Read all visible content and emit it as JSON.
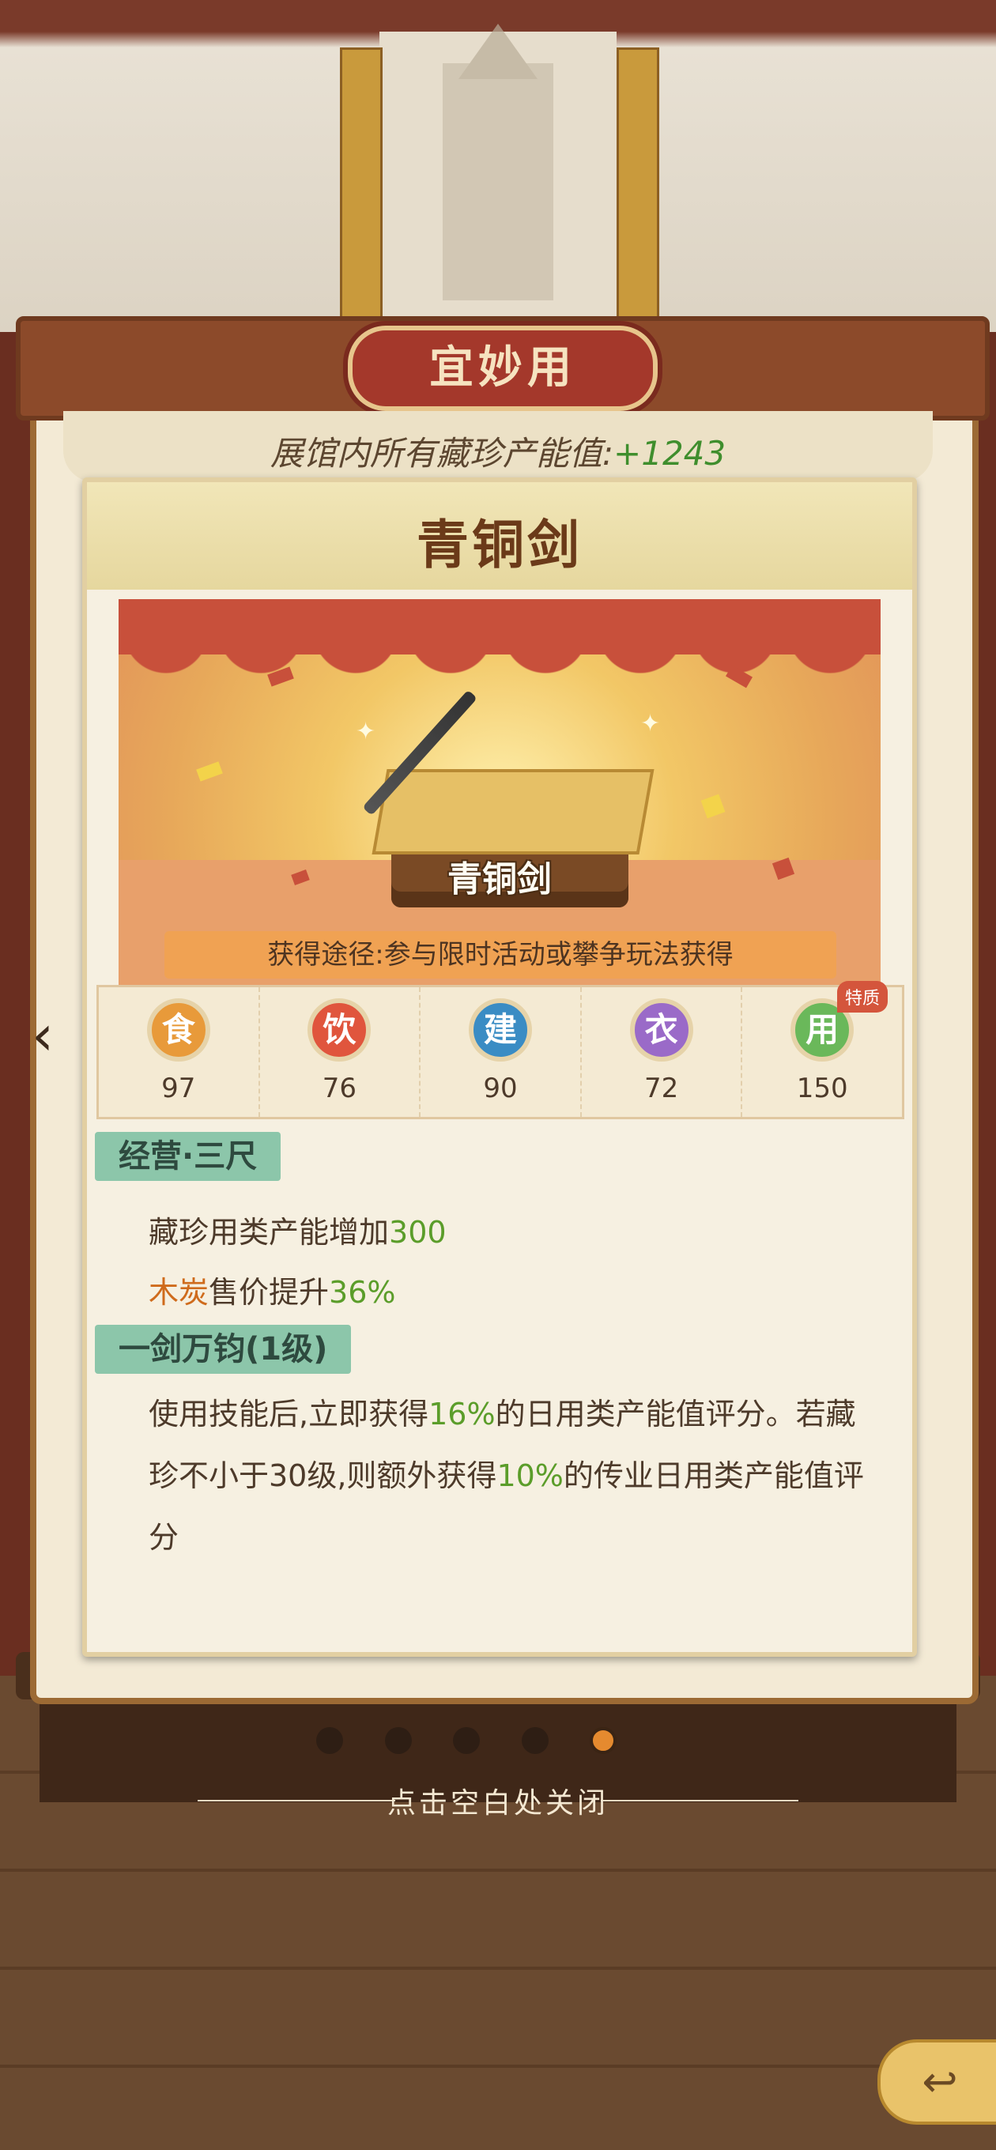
{
  "header": {
    "category_title": "宜妙用",
    "total_label": "展馆内所有藏珍产能值:",
    "total_value": "+1243"
  },
  "card": {
    "title": "青铜剑",
    "image_item_name": "青铜剑",
    "obtain_text": "获得途径:参与限时活动或攀争玩法获得",
    "stats": [
      {
        "glyph": "食",
        "value": "97",
        "color": "#e89a3a"
      },
      {
        "glyph": "饮",
        "value": "76",
        "color": "#e0553d"
      },
      {
        "glyph": "建",
        "value": "90",
        "color": "#3a8cc4"
      },
      {
        "glyph": "衣",
        "value": "72",
        "color": "#9a6ac8"
      },
      {
        "glyph": "用",
        "value": "150",
        "color": "#6ab85a",
        "tag": "特质"
      }
    ],
    "skill1": {
      "name": "经营·三尺",
      "line1_prefix": "藏珍用类产能增加",
      "line1_value": "300",
      "line2_item": "木炭",
      "line2_mid": "售价提升",
      "line2_value": "36%"
    },
    "skill2": {
      "name": "一剑万钧(1级)",
      "d1": "使用技能后,立即获得",
      "v1": "16%",
      "d2": "的日用类产能值评分。若藏珍不小于30级,则额外获得",
      "v2": "10%",
      "d3": "的传业日用类产能值评分"
    }
  },
  "pager": {
    "total": 5,
    "active_index": 4
  },
  "footer": {
    "close_hint": "点击空白处关闭"
  },
  "colors": {
    "accent_green": "#5b9d2a",
    "accent_orange": "#cf6b1c",
    "title_brown": "#6b3a19"
  }
}
